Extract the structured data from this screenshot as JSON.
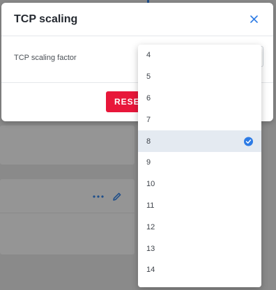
{
  "modal": {
    "title": "TCP scaling",
    "field_label": "TCP scaling factor",
    "reset_label": "RESET"
  },
  "dropdown": {
    "options": [
      "4",
      "5",
      "6",
      "7",
      "8",
      "9",
      "10",
      "11",
      "12",
      "13",
      "14"
    ],
    "selected": "8"
  },
  "colors": {
    "accent": "#2d7be5",
    "reset": "#e8173a",
    "selected_row": "#e4eaf1"
  },
  "icons": {
    "close": "close-icon",
    "check": "check-icon",
    "more": "more-icon",
    "edit": "edit-icon"
  }
}
